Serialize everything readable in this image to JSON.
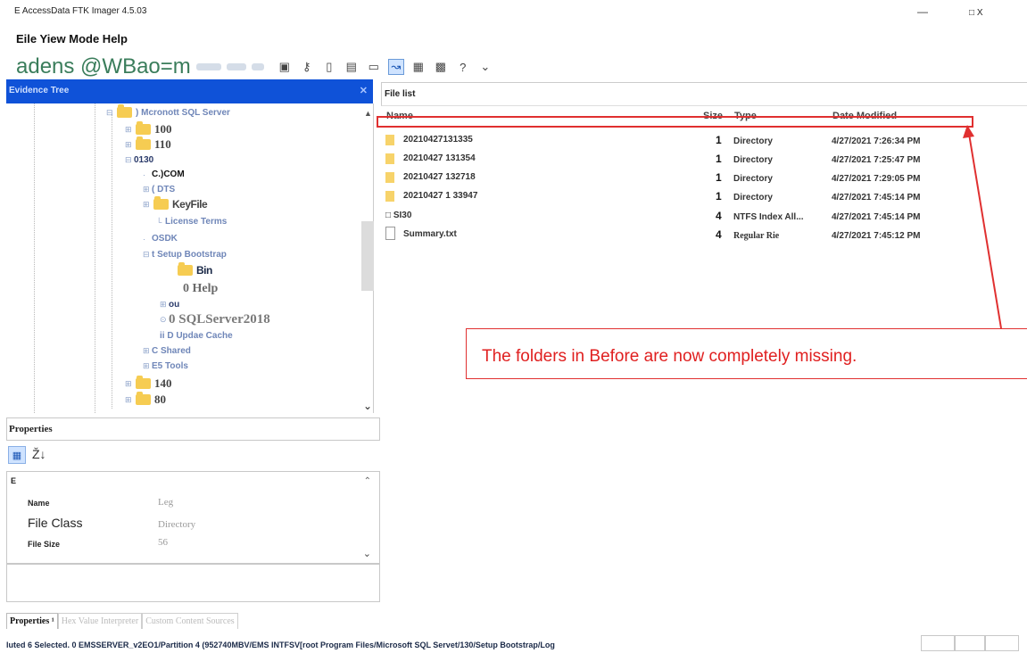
{
  "window": {
    "title": "E AccessData FTK Imager 4.5.03",
    "minimize": "—",
    "close": "□ X"
  },
  "menu": {
    "text": "Eile Yiew Mode Help"
  },
  "toolbar": {
    "text": "adens @WBao=m"
  },
  "evidence_tree": {
    "header": "Evidence Tree",
    "close": "✕",
    "items": [
      {
        "label": ") Mcronott SQL Server"
      },
      {
        "label": "100"
      },
      {
        "label": "110"
      },
      {
        "label": "0130"
      },
      {
        "label": "C.)COM"
      },
      {
        "label": "( DTS"
      },
      {
        "label": "KeyFile"
      },
      {
        "label": "License Terms"
      },
      {
        "label": "OSDK"
      },
      {
        "label": "t Setup Bootstrap"
      },
      {
        "label": "Bin"
      },
      {
        "label": "0 Help"
      },
      {
        "label": "ou"
      },
      {
        "label": "0 SQLServer2018"
      },
      {
        "label": "ii D Updae Cache"
      },
      {
        "label": "C Shared"
      },
      {
        "label": "E5 Tools"
      },
      {
        "label": "140"
      },
      {
        "label": "80"
      }
    ]
  },
  "properties": {
    "header": "Properties",
    "category": "E",
    "rows": [
      {
        "name": "Name",
        "value": "Leg"
      },
      {
        "name": "File Class",
        "value": "Directory"
      },
      {
        "name": "File Size",
        "value": "56"
      }
    ]
  },
  "bottom_tabs": [
    "Properties ¹",
    "Hex Value Interpreter",
    "Custom Content Sources"
  ],
  "status_bar": "luted 6 Selected. 0 EMSSERVER_v2EO1/Partition 4 (952740MBV/EMS INTFSV[root Program Files/Microsoft SQL Servet/130/Setup Bootstrap/Log",
  "file_list": {
    "header": "File list",
    "columns": [
      "Name",
      "Size",
      "Type",
      "Date Modified"
    ],
    "rows": [
      {
        "name": "20210427131335",
        "size": "1",
        "type": "Directory",
        "date": "4/27/2021 7:26:34 PM",
        "icon": "folder-icon"
      },
      {
        "name": "20210427 131354",
        "size": "1",
        "type": "Directory",
        "date": "4/27/2021 7:25:47 PM",
        "icon": "folder-icon"
      },
      {
        "name": "20210427 132718",
        "size": "1",
        "type": "Directory",
        "date": "4/27/2021 7:29:05 PM",
        "icon": "folder-icon"
      },
      {
        "name": "20210427 1 33947",
        "size": "1",
        "type": "Directory",
        "date": "4/27/2021 7:45:14 PM",
        "icon": "folder-icon"
      },
      {
        "name": "□ SI30",
        "size": "4",
        "type": "NTFS Index All...",
        "date": "4/27/2021 7:45:14 PM",
        "icon": "none"
      },
      {
        "name": "Summary.txt",
        "size": "4",
        "type": "Regular Rie",
        "date": "4/27/2021 7:45:12 PM",
        "icon": "document-icon"
      }
    ]
  },
  "annotation": {
    "text": "The folders in Before are now completely missing.",
    "color": "#e02020"
  }
}
